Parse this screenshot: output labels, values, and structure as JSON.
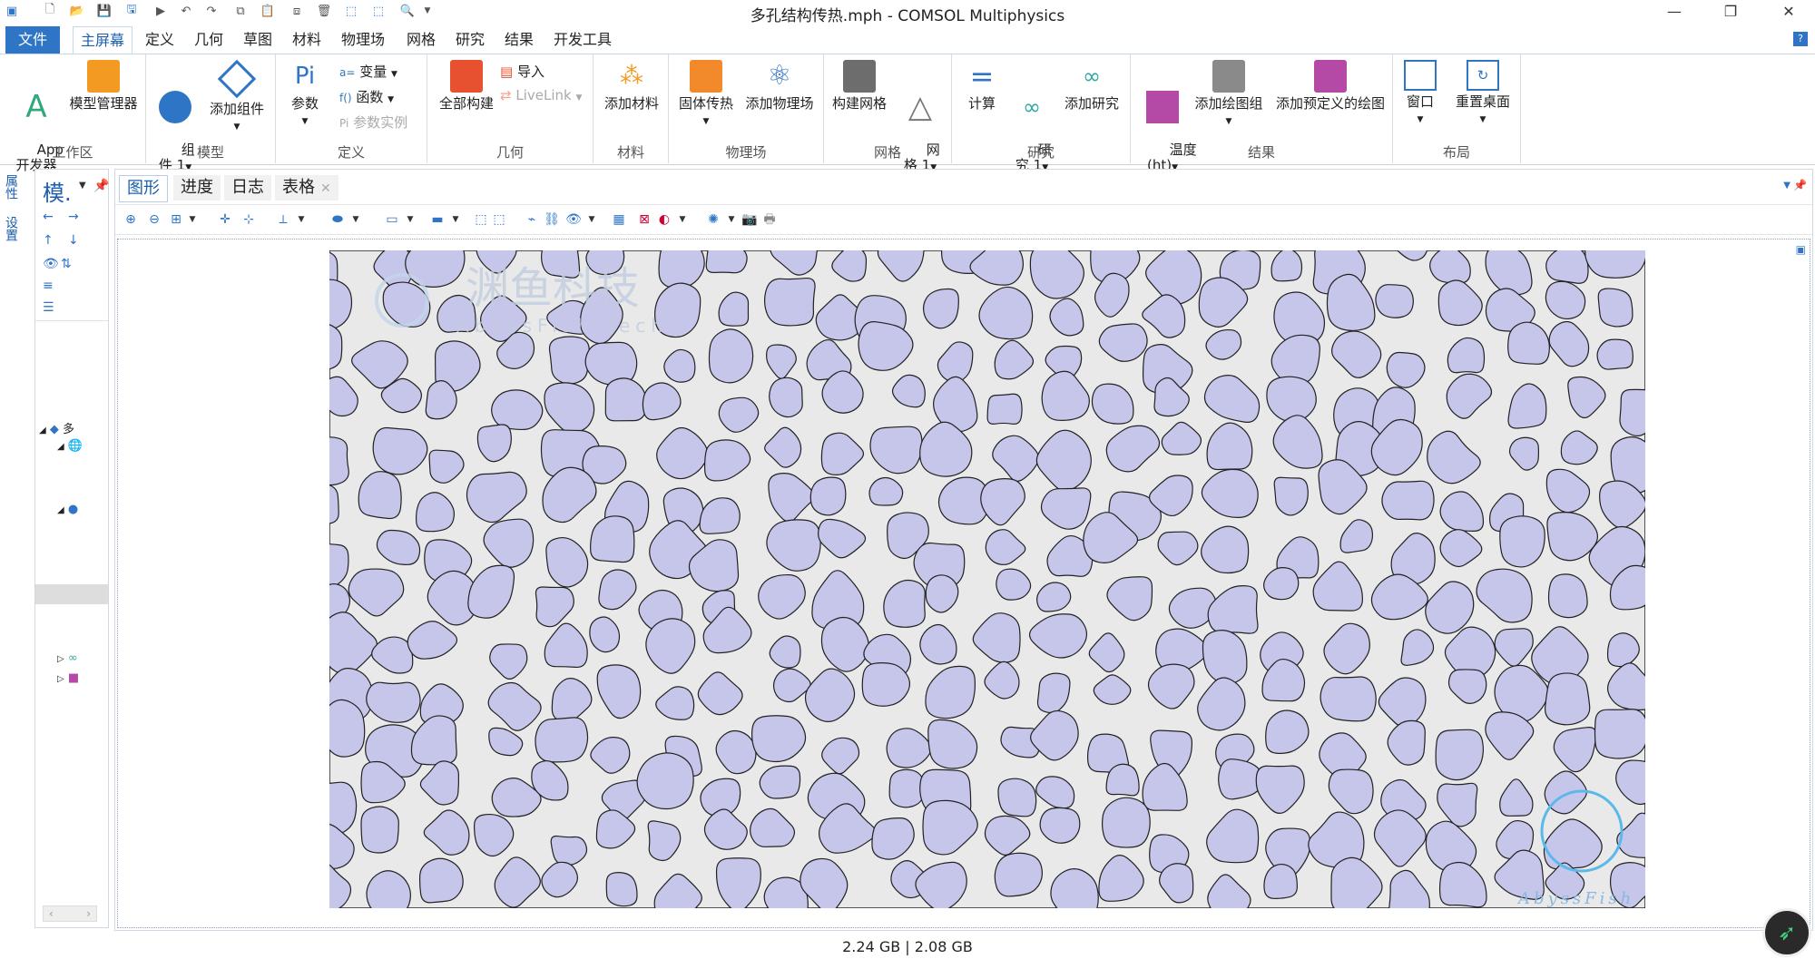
{
  "window": {
    "title": "多孔结构传热.mph - COMSOL Multiphysics",
    "minimize": "—",
    "restore": "❐",
    "close": "✕"
  },
  "ribbon_tabs": [
    "文件",
    "主屏幕",
    "定义",
    "几何",
    "草图",
    "材料",
    "物理场",
    "网格",
    "研究",
    "结果",
    "开发工具"
  ],
  "help": "?",
  "groups": {
    "workspace": {
      "label": "工作区",
      "app_dev": "App\n开发器",
      "model_manager": "模型管理器"
    },
    "model": {
      "label": "模型",
      "component": "组\n件 1",
      "add_component": "添加组件"
    },
    "definitions": {
      "label": "定义",
      "parameters": "参数",
      "variables": "变量",
      "functions": "函数",
      "param_case": "参数实例"
    },
    "geometry": {
      "label": "几何",
      "build_all": "全部构建",
      "import": "导入",
      "livelink": "LiveLink"
    },
    "materials": {
      "label": "材料",
      "add_material": "添加材料"
    },
    "physics": {
      "label": "物理场",
      "solid_heat": "固体传热",
      "add_physics": "添加物理场"
    },
    "mesh": {
      "label": "网格",
      "build_mesh": "构建网格",
      "mesh1": "网\n格 1"
    },
    "study": {
      "label": "研究",
      "compute": "计算",
      "study1": "研\n究 1",
      "add_study": "添加研究"
    },
    "results": {
      "label": "结果",
      "temperature": "温度\n(ht)",
      "add_plot_group": "添加绘图组",
      "add_predefined": "添加预定义的绘图"
    },
    "layout": {
      "label": "布局",
      "window": "窗口",
      "reset_desktop": "重置桌面"
    }
  },
  "side_tabs": [
    "属性",
    "设置"
  ],
  "model_panel": {
    "title": "模.",
    "tree_label": "多"
  },
  "graphics_tabs": [
    "图形",
    "进度",
    "日志",
    "表格"
  ],
  "watermark": {
    "cn": "渊鱼科技",
    "en": "AbyssFish Tech",
    "corner": "AbyssFish"
  },
  "status": "2.24 GB | 2.08 GB",
  "colors": {
    "accent": "#2e75c6",
    "pore_fill": "#c6c6eb",
    "matrix_fill": "#e9e9e9"
  }
}
